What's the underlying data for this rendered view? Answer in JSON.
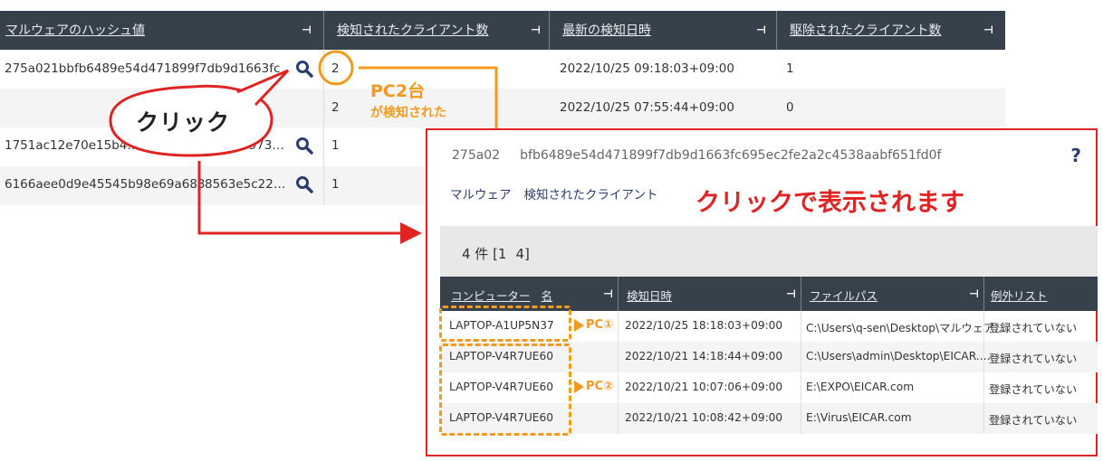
{
  "main_table": {
    "headers": [
      "マルウェアのハッシュ値",
      "検知されたクライアント数",
      "最新の検知日時",
      "駆除されたクライアント数"
    ],
    "rows": [
      {
        "hash": "275a021bbfb6489e54d471899f7db9d1663fc",
        "clients": "2",
        "latest": "2022/10/25 09:18:03+09:00",
        "removed": "1"
      },
      {
        "hash": "",
        "clients": "2",
        "latest": "2022/10/25 07:55:44+09:00",
        "removed": "0"
      },
      {
        "hash": "1751ac12e70e15b4…",
        "hash_tail": "5973…",
        "clients": "1",
        "latest": "",
        "removed": ""
      },
      {
        "hash": "6166aee0d9e45545b98e69a683",
        "hash_tail": "8563e5c22…",
        "clients": "1",
        "latest": "",
        "removed": ""
      }
    ],
    "pin_icon": "pin-icon",
    "search_icon": "magnifier-icon"
  },
  "annotations": {
    "click_label": "クリック",
    "pc_count": "PC2台",
    "pc_count_sub": "が検知された",
    "popup_caption": "クリックで表示されます",
    "pc1_tag": "PC①",
    "pc2_tag": "PC②",
    "accent_orange": "#f39a1e",
    "accent_red": "#e02424"
  },
  "popup": {
    "hash_prefix": "275a02",
    "hash_rest": "bfb6489e54d471899f7db9d1663fc695ec2fe2a2c4538aabf651fd0f",
    "help": "?",
    "subtitle_a": "マルウェア",
    "subtitle_b": "検知されたクライアント",
    "count_a": "4 件 [1",
    "count_b": "4]",
    "headers": [
      "コンピューター",
      "名",
      "検知日時",
      "ファイルパス",
      "例外リスト"
    ],
    "rows": [
      {
        "computer": "LAPTOP-A1UP5N37",
        "date": "2022/10/25 18:18:03+09:00",
        "path": "C:\\Users\\q-sen\\Desktop\\マルウェア…",
        "exception": "登録されていない"
      },
      {
        "computer": "LAPTOP-V4R7UE60",
        "date": "2022/10/21 14:18:44+09:00",
        "path": "C:\\Users\\admin\\Desktop\\EICAR.…",
        "exception": "登録されていない"
      },
      {
        "computer": "LAPTOP-V4R7UE60",
        "date": "2022/10/21 10:07:06+09:00",
        "path": "E:\\EXPO\\EICAR.com",
        "exception": "登録されていない"
      },
      {
        "computer": "LAPTOP-V4R7UE60",
        "date": "2022/10/21 10:08:42+09:00",
        "path": "E:\\Virus\\EICAR.com",
        "exception": "登録されていない"
      }
    ]
  }
}
